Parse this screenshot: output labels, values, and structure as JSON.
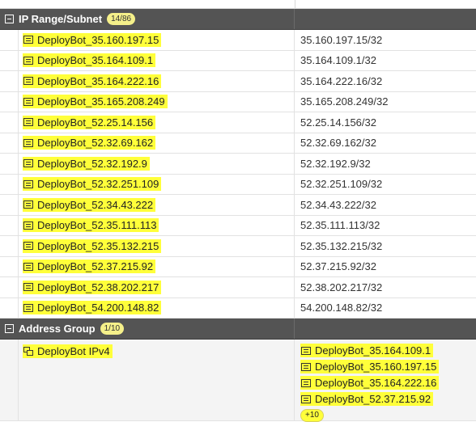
{
  "groups": {
    "ip_range": {
      "title": "IP Range/Subnet",
      "count": "14/86",
      "rows": [
        {
          "name": "DeployBot_35.160.197.15",
          "value": "35.160.197.15/32"
        },
        {
          "name": "DeployBot_35.164.109.1",
          "value": "35.164.109.1/32"
        },
        {
          "name": "DeployBot_35.164.222.16",
          "value": "35.164.222.16/32"
        },
        {
          "name": "DeployBot_35.165.208.249",
          "value": "35.165.208.249/32"
        },
        {
          "name": "DeployBot_52.25.14.156",
          "value": "52.25.14.156/32"
        },
        {
          "name": "DeployBot_52.32.69.162",
          "value": "52.32.69.162/32"
        },
        {
          "name": "DeployBot_52.32.192.9",
          "value": "52.32.192.9/32"
        },
        {
          "name": "DeployBot_52.32.251.109",
          "value": "52.32.251.109/32"
        },
        {
          "name": "DeployBot_52.34.43.222",
          "value": "52.34.43.222/32"
        },
        {
          "name": "DeployBot_52.35.111.113",
          "value": "52.35.111.113/32"
        },
        {
          "name": "DeployBot_52.35.132.215",
          "value": "52.35.132.215/32"
        },
        {
          "name": "DeployBot_52.37.215.92",
          "value": "52.37.215.92/32"
        },
        {
          "name": "DeployBot_52.38.202.217",
          "value": "52.38.202.217/32"
        },
        {
          "name": "DeployBot_54.200.148.82",
          "value": "54.200.148.82/32"
        }
      ]
    },
    "address_group": {
      "title": "Address Group",
      "count": "1/10",
      "row": {
        "name": "DeployBot IPv4",
        "members": [
          "DeployBot_35.164.109.1",
          "DeployBot_35.160.197.15",
          "DeployBot_35.164.222.16",
          "DeployBot_52.37.215.92"
        ],
        "more": "+10"
      }
    }
  },
  "colors": {
    "highlight": "#ffff3a",
    "header_bg": "#545454"
  },
  "icons": {
    "address": "address-object-icon",
    "group": "address-group-icon",
    "collapse": "collapse-toggle-icon"
  }
}
